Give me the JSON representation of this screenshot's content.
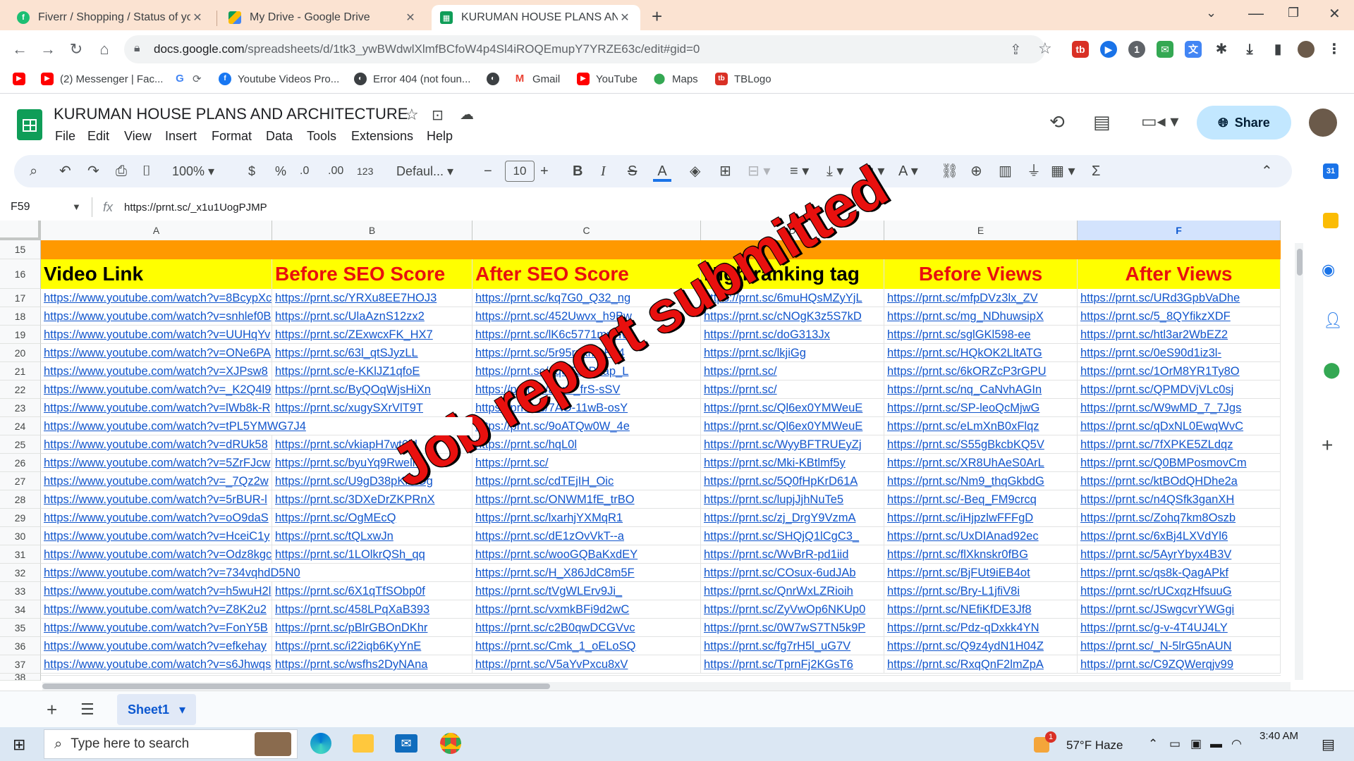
{
  "browser": {
    "tabs": [
      {
        "title": "Fiverr / Shopping / Status of you",
        "icon": "fiverr-icon",
        "color": "#1dbf73"
      },
      {
        "title": "My Drive - Google Drive",
        "icon": "google-drive-icon",
        "color": "#1a73e8"
      },
      {
        "title": "KURUMAN HOUSE PLANS AND",
        "icon": "google-sheets-icon",
        "color": "#0f9d58",
        "active": true
      }
    ],
    "url_host": "docs.google.com",
    "url_path": "/spreadsheets/d/1tk3_ywBWdwlXlmfBCfoW4p4Sl4iROQEmupY7YRZE63c/edit#gid=0",
    "bookmarks": [
      {
        "label": "",
        "icon": "youtube-icon"
      },
      {
        "label": "(2) Messenger | Fac...",
        "icon": "youtube-icon"
      },
      {
        "label": "",
        "icon": "google-icon"
      },
      {
        "label": "Youtube Videos Pro...",
        "icon": "facebook-icon"
      },
      {
        "label": "Error 404 (not foun...",
        "icon": "globe-icon"
      },
      {
        "label": "",
        "icon": "globe-icon"
      },
      {
        "label": "Gmail",
        "icon": "gmail-icon"
      },
      {
        "label": "YouTube",
        "icon": "youtube-icon"
      },
      {
        "label": "Maps",
        "icon": "maps-icon"
      },
      {
        "label": "TBLogo",
        "icon": "tblogo-icon"
      }
    ]
  },
  "sheets": {
    "title": "KURUMAN HOUSE PLANS AND ARCHITECTURE",
    "menu": [
      "File",
      "Edit",
      "View",
      "Insert",
      "Format",
      "Data",
      "Tools",
      "Extensions",
      "Help"
    ],
    "share_label": "Share",
    "toolbar": {
      "zoom": "100%",
      "currency": "$",
      "percent": "%",
      "dec_less": ".0",
      "dec_more": ".00",
      "number_fmt": "123",
      "font": "Defaul...",
      "font_size": "10"
    },
    "name_box": "F59",
    "formula": "https://prnt.sc/_x1u1UogPJMP",
    "columns": [
      "A",
      "B",
      "C",
      "D",
      "E",
      "F"
    ],
    "selected_column": "F",
    "headers": [
      "Video Link",
      "Before SEO Score",
      "After SEO Score",
      "High ranking tag",
      "Before Views",
      "After Views"
    ],
    "header_colors": [
      "#000000",
      "#e8100e",
      "#e8100e",
      "#000000",
      "#e8100e",
      "#e8100e"
    ],
    "header_row_bg": "#ffff00",
    "band_color": "#ff9900",
    "row_numbers": [
      "15",
      "16",
      "17",
      "18",
      "19",
      "20",
      "21",
      "22",
      "23",
      "24",
      "25",
      "26",
      "27",
      "28",
      "29",
      "30",
      "31",
      "32",
      "33",
      "34",
      "35",
      "36",
      "37",
      "38"
    ],
    "rows": [
      [
        "https://www.youtube.com/watch?v=8BcypXc",
        "https://prnt.sc/YRXu8EE7HOJ3",
        "https://prnt.sc/kq7G0_Q32_ng",
        "https://prnt.sc/6muHQsMZyYjL",
        "https://prnt.sc/mfpDVz3lx_ZV",
        "https://prnt.sc/URd3GpbVaDhe"
      ],
      [
        "https://www.youtube.com/watch?v=snhlef0B",
        "https://prnt.sc/UlaAznS12zx2",
        "https://prnt.sc/452Uwvx_h9Bw",
        "https://prnt.sc/cNOgK3z5S7kD",
        "https://prnt.sc/mg_NDhuwsipX",
        "https://prnt.sc/5_8QYfikzXDF"
      ],
      [
        "https://www.youtube.com/watch?v=UUHqYv",
        "https://prnt.sc/ZExwcxFK_HX7",
        "https://prnt.sc/lK6c5771mpHv",
        "https://prnt.sc/doG313Jx",
        "https://prnt.sc/sglGKl598-ee",
        "https://prnt.sc/htl3ar2WbEZ2"
      ],
      [
        "https://www.youtube.com/watch?v=ONe6PA",
        "https://prnt.sc/63l_qtSJyzLL",
        "https://prnt.sc/5r95rpkmaHv4",
        "https://prnt.sc/lkjiGg",
        "https://prnt.sc/HQkOK2LltATG",
        "https://prnt.sc/0eS90d1iz3l-"
      ],
      [
        "https://www.youtube.com/watch?v=XJPsw8",
        "https://prnt.sc/e-KKlJZ1qfoE",
        "https://prnt.sc/qq6E52P3ap_L",
        "https://prnt.sc/",
        "https://prnt.sc/6kORZcP3rGPU",
        "https://prnt.sc/1OrM8YR1Ty8O"
      ],
      [
        "https://www.youtube.com/watch?v=_K2Q4l9",
        "https://prnt.sc/ByQOqWjsHiXn",
        "https://prnt.sc/aryO_frS-sSV",
        "https://prnt.sc/",
        "https://prnt.sc/nq_CaNvhAGIn",
        "https://prnt.sc/QPMDVjVLc0sj"
      ],
      [
        "https://www.youtube.com/watch?v=lWb8k-R",
        "https://prnt.sc/xugySXrVlT9T",
        "https://prnt.sc/7AO-11wB-osY",
        "https://prnt.sc/Ql6ex0YMWeuE",
        "https://prnt.sc/SP-leoQcMjwG",
        "https://prnt.sc/W9wMD_7_7Jgs"
      ],
      [
        "https://www.youtube.com/watch?v=tPL5YMWG7J4",
        "",
        "https://prnt.sc/9oATQw0W_4e",
        "https://prnt.sc/Ql6ex0YMWeuE",
        "https://prnt.sc/eLmXnB0xFlqz",
        "https://prnt.sc/qDxNL0EwqWvC"
      ],
      [
        "https://www.youtube.com/watch?v=dRUk58",
        "https://prnt.sc/vkiapH7wt6hl",
        "https://prnt.sc/hqL0l",
        "https://prnt.sc/WyyBFTRUEyZj",
        "https://prnt.sc/S55gBkcbKQ5V",
        "https://prnt.sc/7fXPKE5ZLdqz"
      ],
      [
        "https://www.youtube.com/watch?v=5ZrFJcw",
        "https://prnt.sc/byuYq9Rwelie",
        "https://prnt.sc/",
        "https://prnt.sc/Mki-KBtlmf5y",
        "https://prnt.sc/XR8UhAeS0ArL",
        "https://prnt.sc/Q0BMPosmovCm"
      ],
      [
        "https://www.youtube.com/watch?v=_7Qz2w",
        "https://prnt.sc/U9gD38pKiMOg",
        "https://prnt.sc/cdTEjIH_Oic",
        "https://prnt.sc/5Q0fHpKrD61A",
        "https://prnt.sc/Nm9_thqGkbdG",
        "https://prnt.sc/ktBOdQHDhe2a"
      ],
      [
        "https://www.youtube.com/watch?v=5rBUR-l",
        "https://prnt.sc/3DXeDrZKPRnX",
        "https://prnt.sc/ONWM1fE_trBO",
        "https://prnt.sc/lupjJjhNuTe5",
        "https://prnt.sc/-Beq_FM9crcq",
        "https://prnt.sc/n4QSfk3ganXH"
      ],
      [
        "https://www.youtube.com/watch?v=oO9daS",
        "https://prnt.sc/OgMEcQ",
        "https://prnt.sc/lxarhjYXMqR1",
        "https://prnt.sc/zj_DrgY9VzmA",
        "https://prnt.sc/iHjpzlwFFFgD",
        "https://prnt.sc/Zohq7km8Oszb"
      ],
      [
        "https://www.youtube.com/watch?v=HceiC1y",
        "https://prnt.sc/tQLxwJn",
        "https://prnt.sc/dE1zOvVkT--a",
        "https://prnt.sc/SHQjQ1lCgC3_",
        "https://prnt.sc/UxDIAnad92ec",
        "https://prnt.sc/6xBj4LXVdYl6"
      ],
      [
        "https://www.youtube.com/watch?v=Odz8kgc",
        "https://prnt.sc/1LOlkrQSh_qq",
        "https://prnt.sc/wooGQBaKxdEY",
        "https://prnt.sc/WvBrR-pd1iid",
        "https://prnt.sc/flXknskr0fBG",
        "https://prnt.sc/5AyrYbyx4B3V"
      ],
      [
        "https://www.youtube.com/watch?v=734vqhdD5N0",
        "",
        "https://prnt.sc/H_X86JdC8m5F",
        "https://prnt.sc/COsux-6udJAb",
        "https://prnt.sc/BjFUt9iEB4ot",
        "https://prnt.sc/qs8k-QagAPkf"
      ],
      [
        "https://www.youtube.com/watch?v=h5wuH2l",
        "https://prnt.sc/6X1qTfSObp0f",
        "https://prnt.sc/tVgWLErv9Ji_",
        "https://prnt.sc/QnrWxLZRioih",
        "https://prnt.sc/Bry-L1jfiV8i",
        "https://prnt.sc/rUCxqzHfsuuG"
      ],
      [
        "https://www.youtube.com/watch?v=Z8K2u2",
        "https://prnt.sc/458LPqXaB393",
        "https://prnt.sc/vxmkBFi9d2wC",
        "https://prnt.sc/ZyVwOp6NKUp0",
        "https://prnt.sc/NEfiKfDE3Jf8",
        "https://prnt.sc/JSwgcvrYWGgi"
      ],
      [
        "https://www.youtube.com/watch?v=FonY5B",
        "https://prnt.sc/pBlrGBOnDKhr",
        "https://prnt.sc/c2B0qwDCGVvc",
        "https://prnt.sc/0W7wS7TN5k9P",
        "https://prnt.sc/Pdz-qDxkk4YN",
        "https://prnt.sc/g-v-4T4UJ4LY"
      ],
      [
        "https://www.youtube.com/watch?v=efkehay",
        "https://prnt.sc/i22iqb6KyYnE",
        "https://prnt.sc/Cmk_1_oELoSQ",
        "https://prnt.sc/fg7rH5l_uG7V",
        "https://prnt.sc/Q9z4ydN1H04Z",
        "https://prnt.sc/_N-5lrG5nAUN"
      ],
      [
        "https://www.youtube.com/watch?v=s6Jhwqs",
        "https://prnt.sc/wsfhs2DyNAna",
        "https://prnt.sc/V5aYvPxcu8xV",
        "https://prnt.sc/TprnFj2KGsT6",
        "https://prnt.sc/RxqQnF2lmZpA",
        "https://prnt.sc/C9ZQWerqjv99"
      ]
    ],
    "stamp_text": "Job report submitted",
    "sheet_tab": "Sheet1"
  },
  "taskbar": {
    "search_placeholder": "Type here to search",
    "weather": "57°F  Haze",
    "time": "3:40 AM",
    "notification_count": "1"
  }
}
